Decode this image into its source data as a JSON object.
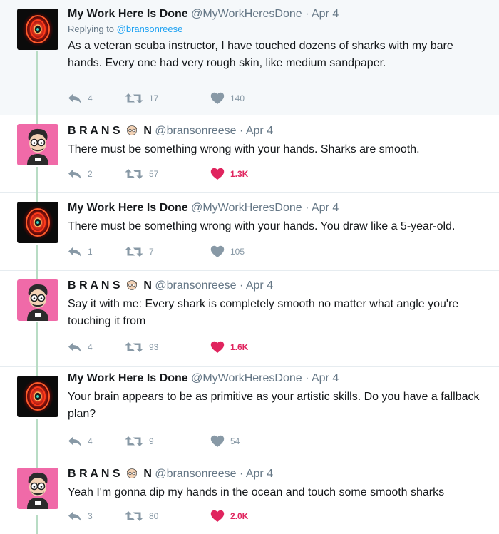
{
  "tweets": [
    {
      "display_name": "My Work Here Is Done",
      "username": "@MyWorkHeresDone",
      "separator": "·",
      "date": "Apr 4",
      "reply_prefix": "Replying to",
      "reply_to": "@bransonreese",
      "text": "As a veteran scuba instructor, I have touched dozens of sharks with my bare hands. Every one had very rough skin, like medium sandpaper.",
      "replies": "4",
      "retweets": "17",
      "likes": "140",
      "liked": false
    },
    {
      "display_name_a": "B R A N S",
      "display_name_b": "N",
      "username": "@bransonreese",
      "separator": "·",
      "date": "Apr 4",
      "text": "There must be something wrong with your hands. Sharks are smooth.",
      "replies": "2",
      "retweets": "57",
      "likes": "1.3K",
      "liked": true
    },
    {
      "display_name": "My Work Here Is Done",
      "username": "@MyWorkHeresDone",
      "separator": "·",
      "date": "Apr 4",
      "text": "There must be something wrong with your hands. You draw like a 5-year-old.",
      "replies": "1",
      "retweets": "7",
      "likes": "105",
      "liked": false
    },
    {
      "display_name_a": "B R A N S",
      "display_name_b": "N",
      "username": "@bransonreese",
      "separator": "·",
      "date": "Apr 4",
      "text": "Say it with me: Every shark is completely smooth no matter what angle you're touching it from",
      "replies": "4",
      "retweets": "93",
      "likes": "1.6K",
      "liked": true
    },
    {
      "display_name": "My Work Here Is Done",
      "username": "@MyWorkHeresDone",
      "separator": "·",
      "date": "Apr 4",
      "text": "Your brain appears to be as primitive as your artistic skills. Do you have a fallback plan?",
      "replies": "4",
      "retweets": "9",
      "likes": "54",
      "liked": false
    },
    {
      "display_name_a": "B R A N S",
      "display_name_b": "N",
      "username": "@bransonreese",
      "separator": "·",
      "date": "Apr 4",
      "text": "Yeah I'm gonna dip my hands in the ocean and touch some smooth sharks",
      "replies": "3",
      "retweets": "80",
      "likes": "2.0K",
      "liked": true
    }
  ],
  "colors": {
    "like_active": "#e0245e",
    "link": "#1da1f2",
    "muted": "#657786",
    "thread_line": "#b8dcc4",
    "highlight_bg": "#f5f8fa"
  },
  "icons": [
    "reply-icon",
    "retweet-icon",
    "heart-icon",
    "spiral-avatar",
    "cartoon-avatar",
    "cartoon-face-emoji"
  ]
}
